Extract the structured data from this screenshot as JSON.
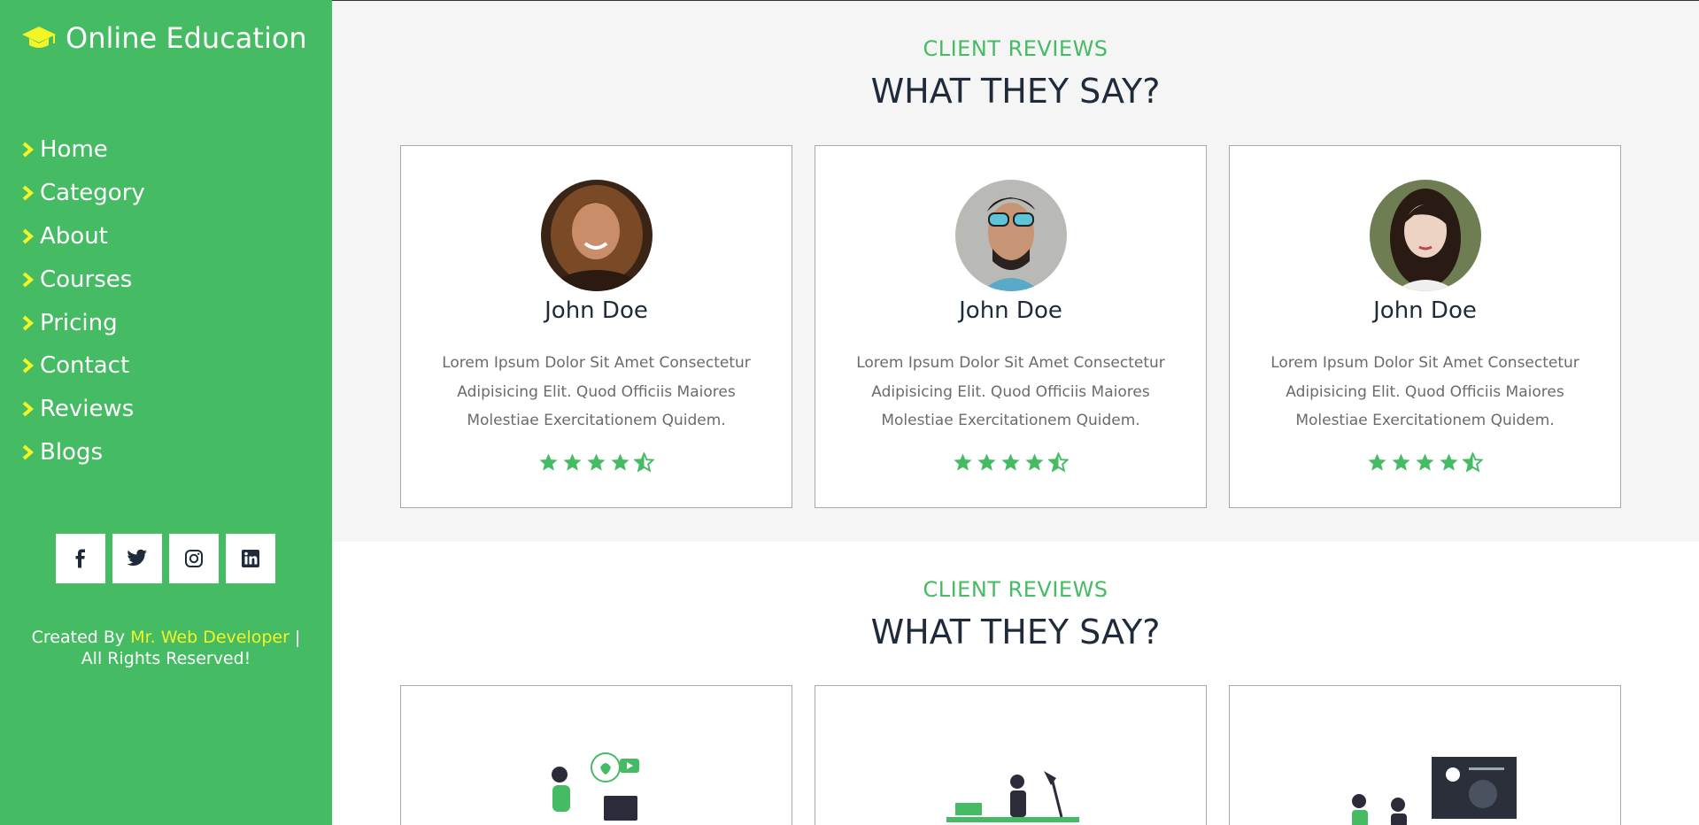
{
  "brand": {
    "title": "Online Education",
    "icon": "graduation-cap-icon",
    "icon_color": "#f3f527"
  },
  "colors": {
    "accent": "#45bb64",
    "highlight": "#f3f527",
    "heading": "#1f2b3a"
  },
  "nav": {
    "items": [
      {
        "label": "Home"
      },
      {
        "label": "Category"
      },
      {
        "label": "About"
      },
      {
        "label": "Courses"
      },
      {
        "label": "Pricing"
      },
      {
        "label": "Contact"
      },
      {
        "label": "Reviews"
      },
      {
        "label": "Blogs"
      }
    ]
  },
  "social": [
    "facebook-icon",
    "twitter-icon",
    "instagram-icon",
    "linkedin-icon"
  ],
  "footer": {
    "prefix": "Created By",
    "author": "Mr. Web Developer",
    "sep": "|",
    "rights": "All Rights Reserved!"
  },
  "reviews": {
    "subheading": "CLIENT REVIEWS",
    "heading": "WHAT THEY SAY?",
    "cards": [
      {
        "name": "John Doe",
        "text": "Lorem Ipsum Dolor Sit Amet Consectetur Adipisicing Elit. Quod Officiis Maiores Molestiae Exercitationem Quidem.",
        "rating": 4.5
      },
      {
        "name": "John Doe",
        "text": "Lorem Ipsum Dolor Sit Amet Consectetur Adipisicing Elit. Quod Officiis Maiores Molestiae Exercitationem Quidem.",
        "rating": 4.5
      },
      {
        "name": "John Doe",
        "text": "Lorem Ipsum Dolor Sit Amet Consectetur Adipisicing Elit. Quod Officiis Maiores Molestiae Exercitationem Quidem.",
        "rating": 4.5
      }
    ]
  },
  "reviews2": {
    "subheading": "CLIENT REVIEWS",
    "heading": "WHAT THEY SAY?"
  }
}
